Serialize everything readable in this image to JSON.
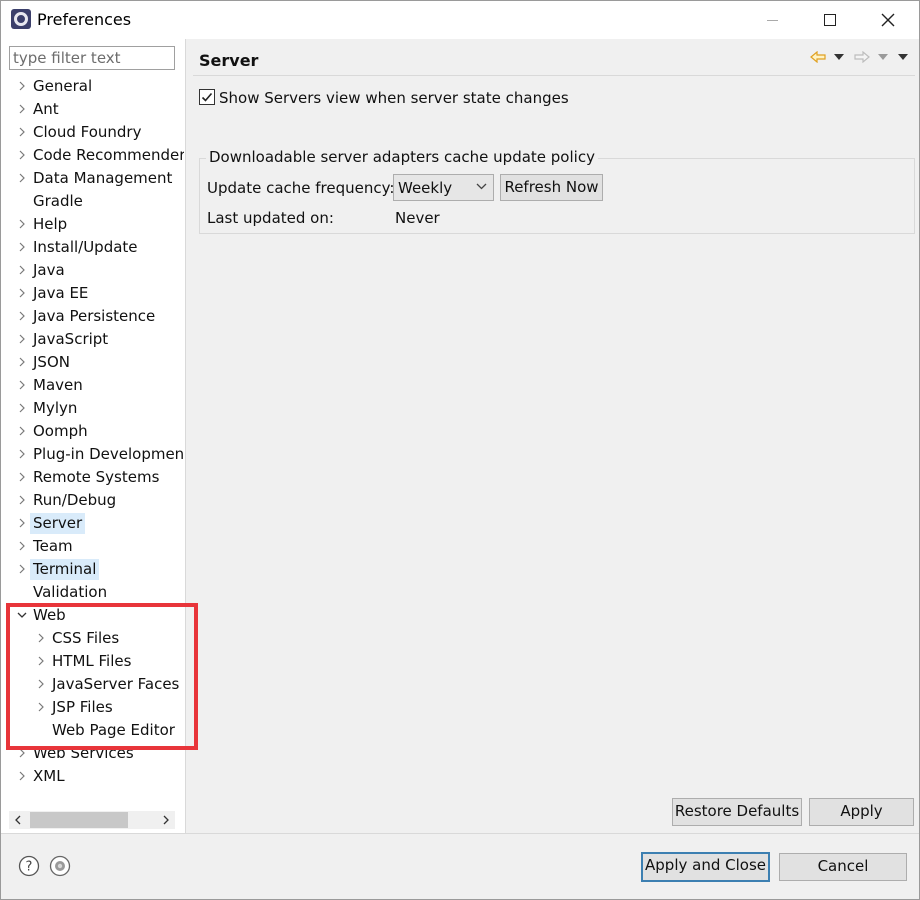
{
  "window": {
    "title": "Preferences"
  },
  "filter": {
    "placeholder": "type filter text"
  },
  "tree": {
    "items": [
      {
        "label": "General",
        "expander": "collapsed",
        "depth": 0
      },
      {
        "label": "Ant",
        "expander": "collapsed",
        "depth": 0
      },
      {
        "label": "Cloud Foundry",
        "expander": "collapsed",
        "depth": 0
      },
      {
        "label": "Code Recommenders",
        "expander": "collapsed",
        "depth": 0
      },
      {
        "label": "Data Management",
        "expander": "collapsed",
        "depth": 0
      },
      {
        "label": "Gradle",
        "expander": "none",
        "depth": 0
      },
      {
        "label": "Help",
        "expander": "collapsed",
        "depth": 0
      },
      {
        "label": "Install/Update",
        "expander": "collapsed",
        "depth": 0
      },
      {
        "label": "Java",
        "expander": "collapsed",
        "depth": 0
      },
      {
        "label": "Java EE",
        "expander": "collapsed",
        "depth": 0
      },
      {
        "label": "Java Persistence",
        "expander": "collapsed",
        "depth": 0
      },
      {
        "label": "JavaScript",
        "expander": "collapsed",
        "depth": 0
      },
      {
        "label": "JSON",
        "expander": "collapsed",
        "depth": 0
      },
      {
        "label": "Maven",
        "expander": "collapsed",
        "depth": 0
      },
      {
        "label": "Mylyn",
        "expander": "collapsed",
        "depth": 0
      },
      {
        "label": "Oomph",
        "expander": "collapsed",
        "depth": 0
      },
      {
        "label": "Plug-in Development",
        "expander": "collapsed",
        "depth": 0
      },
      {
        "label": "Remote Systems",
        "expander": "collapsed",
        "depth": 0
      },
      {
        "label": "Run/Debug",
        "expander": "collapsed",
        "depth": 0
      },
      {
        "label": "Server",
        "expander": "collapsed",
        "depth": 0,
        "selected": true
      },
      {
        "label": "Team",
        "expander": "collapsed",
        "depth": 0
      },
      {
        "label": "Terminal",
        "expander": "collapsed",
        "depth": 0,
        "selected": true
      },
      {
        "label": "Validation",
        "expander": "none",
        "depth": 0
      },
      {
        "label": "Web",
        "expander": "expanded",
        "depth": 0
      },
      {
        "label": "CSS Files",
        "expander": "collapsed",
        "depth": 1
      },
      {
        "label": "HTML Files",
        "expander": "collapsed",
        "depth": 1
      },
      {
        "label": "JavaServer Faces Tools",
        "expander": "collapsed",
        "depth": 1
      },
      {
        "label": "JSP Files",
        "expander": "collapsed",
        "depth": 1
      },
      {
        "label": "Web Page Editor",
        "expander": "none",
        "depth": 1
      },
      {
        "label": "Web Services",
        "expander": "collapsed",
        "depth": 0
      },
      {
        "label": "XML",
        "expander": "collapsed",
        "depth": 0
      }
    ]
  },
  "page": {
    "title": "Server",
    "show_servers_view": {
      "label": "Show Servers view when server state changes",
      "checked": true
    },
    "cache_group": {
      "legend": "Downloadable server adapters cache update policy",
      "frequency_label": "Update cache frequency:",
      "frequency_value": "Weekly",
      "refresh_button": "Refresh Now",
      "last_updated_label": "Last updated on:",
      "last_updated_value": "Never"
    }
  },
  "buttons": {
    "restore_defaults": "Restore Defaults",
    "apply": "Apply",
    "apply_and_close": "Apply and Close",
    "cancel": "Cancel"
  },
  "colors": {
    "selection": "#d9ebfa",
    "highlight_box": "#e8353a",
    "default_button_border": "#3c7fb1",
    "back_arrow": "#e0a020"
  }
}
